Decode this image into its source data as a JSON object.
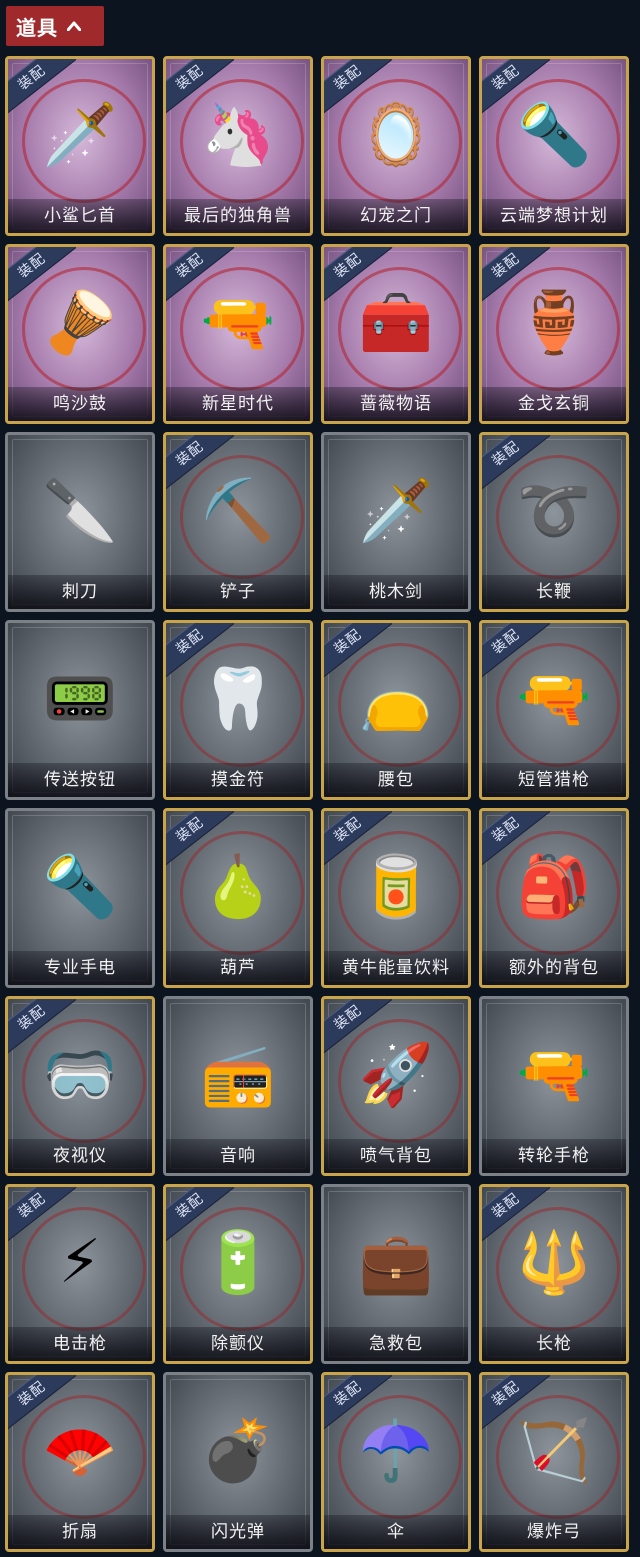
{
  "header": {
    "title": "道具",
    "toggle_icon": "chevron-up-icon"
  },
  "badge_text": "装配",
  "items": [
    {
      "name": "小鲨匕首",
      "style": "purple",
      "equipped": true,
      "icon": "🗡️"
    },
    {
      "name": "最后的独角兽",
      "style": "purple",
      "equipped": true,
      "icon": "🦄"
    },
    {
      "name": "幻宠之门",
      "style": "purple",
      "equipped": true,
      "icon": "🪞"
    },
    {
      "name": "云端梦想计划",
      "style": "purple",
      "equipped": true,
      "icon": "🔦"
    },
    {
      "name": "鸣沙鼓",
      "style": "purple",
      "equipped": true,
      "icon": "🪘"
    },
    {
      "name": "新星时代",
      "style": "purple",
      "equipped": true,
      "icon": "🔫"
    },
    {
      "name": "蔷薇物语",
      "style": "purple",
      "equipped": true,
      "icon": "🧰"
    },
    {
      "name": "金戈玄铜",
      "style": "purple",
      "equipped": true,
      "icon": "🏺"
    },
    {
      "name": "刺刀",
      "style": "grey",
      "equipped": false,
      "icon": "🔪"
    },
    {
      "name": "铲子",
      "style": "grey",
      "equipped": true,
      "icon": "⛏️"
    },
    {
      "name": "桃木剑",
      "style": "grey",
      "equipped": false,
      "icon": "🗡️"
    },
    {
      "name": "长鞭",
      "style": "grey",
      "equipped": true,
      "icon": "➰"
    },
    {
      "name": "传送按钮",
      "style": "grey",
      "equipped": false,
      "icon": "📟"
    },
    {
      "name": "摸金符",
      "style": "grey",
      "equipped": true,
      "icon": "🦷"
    },
    {
      "name": "腰包",
      "style": "grey",
      "equipped": true,
      "icon": "👝"
    },
    {
      "name": "短管猎枪",
      "style": "grey",
      "equipped": true,
      "icon": "🔫"
    },
    {
      "name": "专业手电",
      "style": "grey",
      "equipped": false,
      "icon": "🔦"
    },
    {
      "name": "葫芦",
      "style": "grey",
      "equipped": true,
      "icon": "🍐"
    },
    {
      "name": "黄牛能量饮料",
      "style": "grey",
      "equipped": true,
      "icon": "🥫"
    },
    {
      "name": "额外的背包",
      "style": "grey",
      "equipped": true,
      "icon": "🎒"
    },
    {
      "name": "夜视仪",
      "style": "grey",
      "equipped": true,
      "icon": "🥽"
    },
    {
      "name": "音响",
      "style": "grey",
      "equipped": false,
      "icon": "📻"
    },
    {
      "name": "喷气背包",
      "style": "grey",
      "equipped": true,
      "icon": "🚀"
    },
    {
      "name": "转轮手枪",
      "style": "grey",
      "equipped": false,
      "icon": "🔫"
    },
    {
      "name": "电击枪",
      "style": "grey",
      "equipped": true,
      "icon": "⚡"
    },
    {
      "name": "除颤仪",
      "style": "grey",
      "equipped": true,
      "icon": "🔋"
    },
    {
      "name": "急救包",
      "style": "grey",
      "equipped": false,
      "icon": "💼"
    },
    {
      "name": "长枪",
      "style": "grey",
      "equipped": true,
      "icon": "🔱"
    },
    {
      "name": "折扇",
      "style": "grey",
      "equipped": true,
      "icon": "🪭"
    },
    {
      "name": "闪光弹",
      "style": "grey",
      "equipped": false,
      "icon": "💣"
    },
    {
      "name": "伞",
      "style": "grey",
      "equipped": true,
      "icon": "☂️"
    },
    {
      "name": "爆炸弓",
      "style": "grey",
      "equipped": true,
      "icon": "🏹"
    }
  ]
}
